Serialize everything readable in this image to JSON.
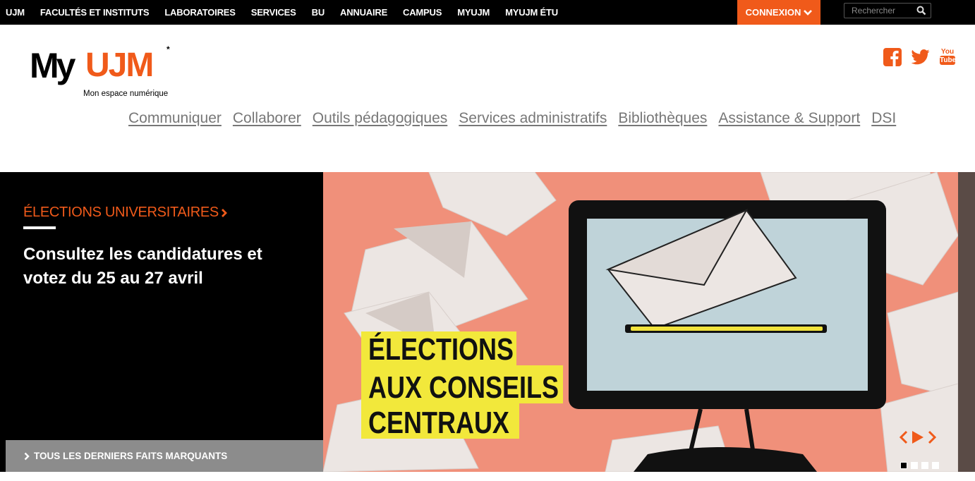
{
  "topnav": {
    "items": [
      {
        "label": "UJM"
      },
      {
        "label": "FACULTÉS ET INSTITUTS"
      },
      {
        "label": "LABORATOIRES"
      },
      {
        "label": "SERVICES"
      },
      {
        "label": "BU"
      },
      {
        "label": "ANNUAIRE"
      },
      {
        "label": "CAMPUS"
      },
      {
        "label": "MYUJM"
      },
      {
        "label": "MYUJM ÉTU"
      }
    ],
    "login_label": "CONNEXION",
    "search_placeholder": "Rechercher"
  },
  "brand": {
    "logo_my": "My",
    "logo_ujm": "UJM",
    "tagline": "Mon espace numérique",
    "asterisk": "*",
    "accent_color": "#f05a1a"
  },
  "social": {
    "youtube_top": "You",
    "youtube_bottom": "Tube"
  },
  "mainnav": {
    "items": [
      {
        "label": "Communiquer"
      },
      {
        "label": "Collaborer"
      },
      {
        "label": "Outils pédagogiques"
      },
      {
        "label": "Services administratifs"
      },
      {
        "label": "Bibliothèques"
      },
      {
        "label": "Assistance & Support"
      },
      {
        "label": "DSI"
      }
    ]
  },
  "hero": {
    "kicker": "ÉLECTIONS UNIVERSITAIRES",
    "title": "Consultez les candidatures et votez du 25 au 27 avril",
    "all_news": "TOUS LES DERNIERS FAITS MARQUANTS",
    "image_text": [
      "ÉLECTIONS",
      "AUX CONSEILS",
      "CENTRAUX"
    ],
    "slide_count": 4,
    "active_slide": 1
  }
}
